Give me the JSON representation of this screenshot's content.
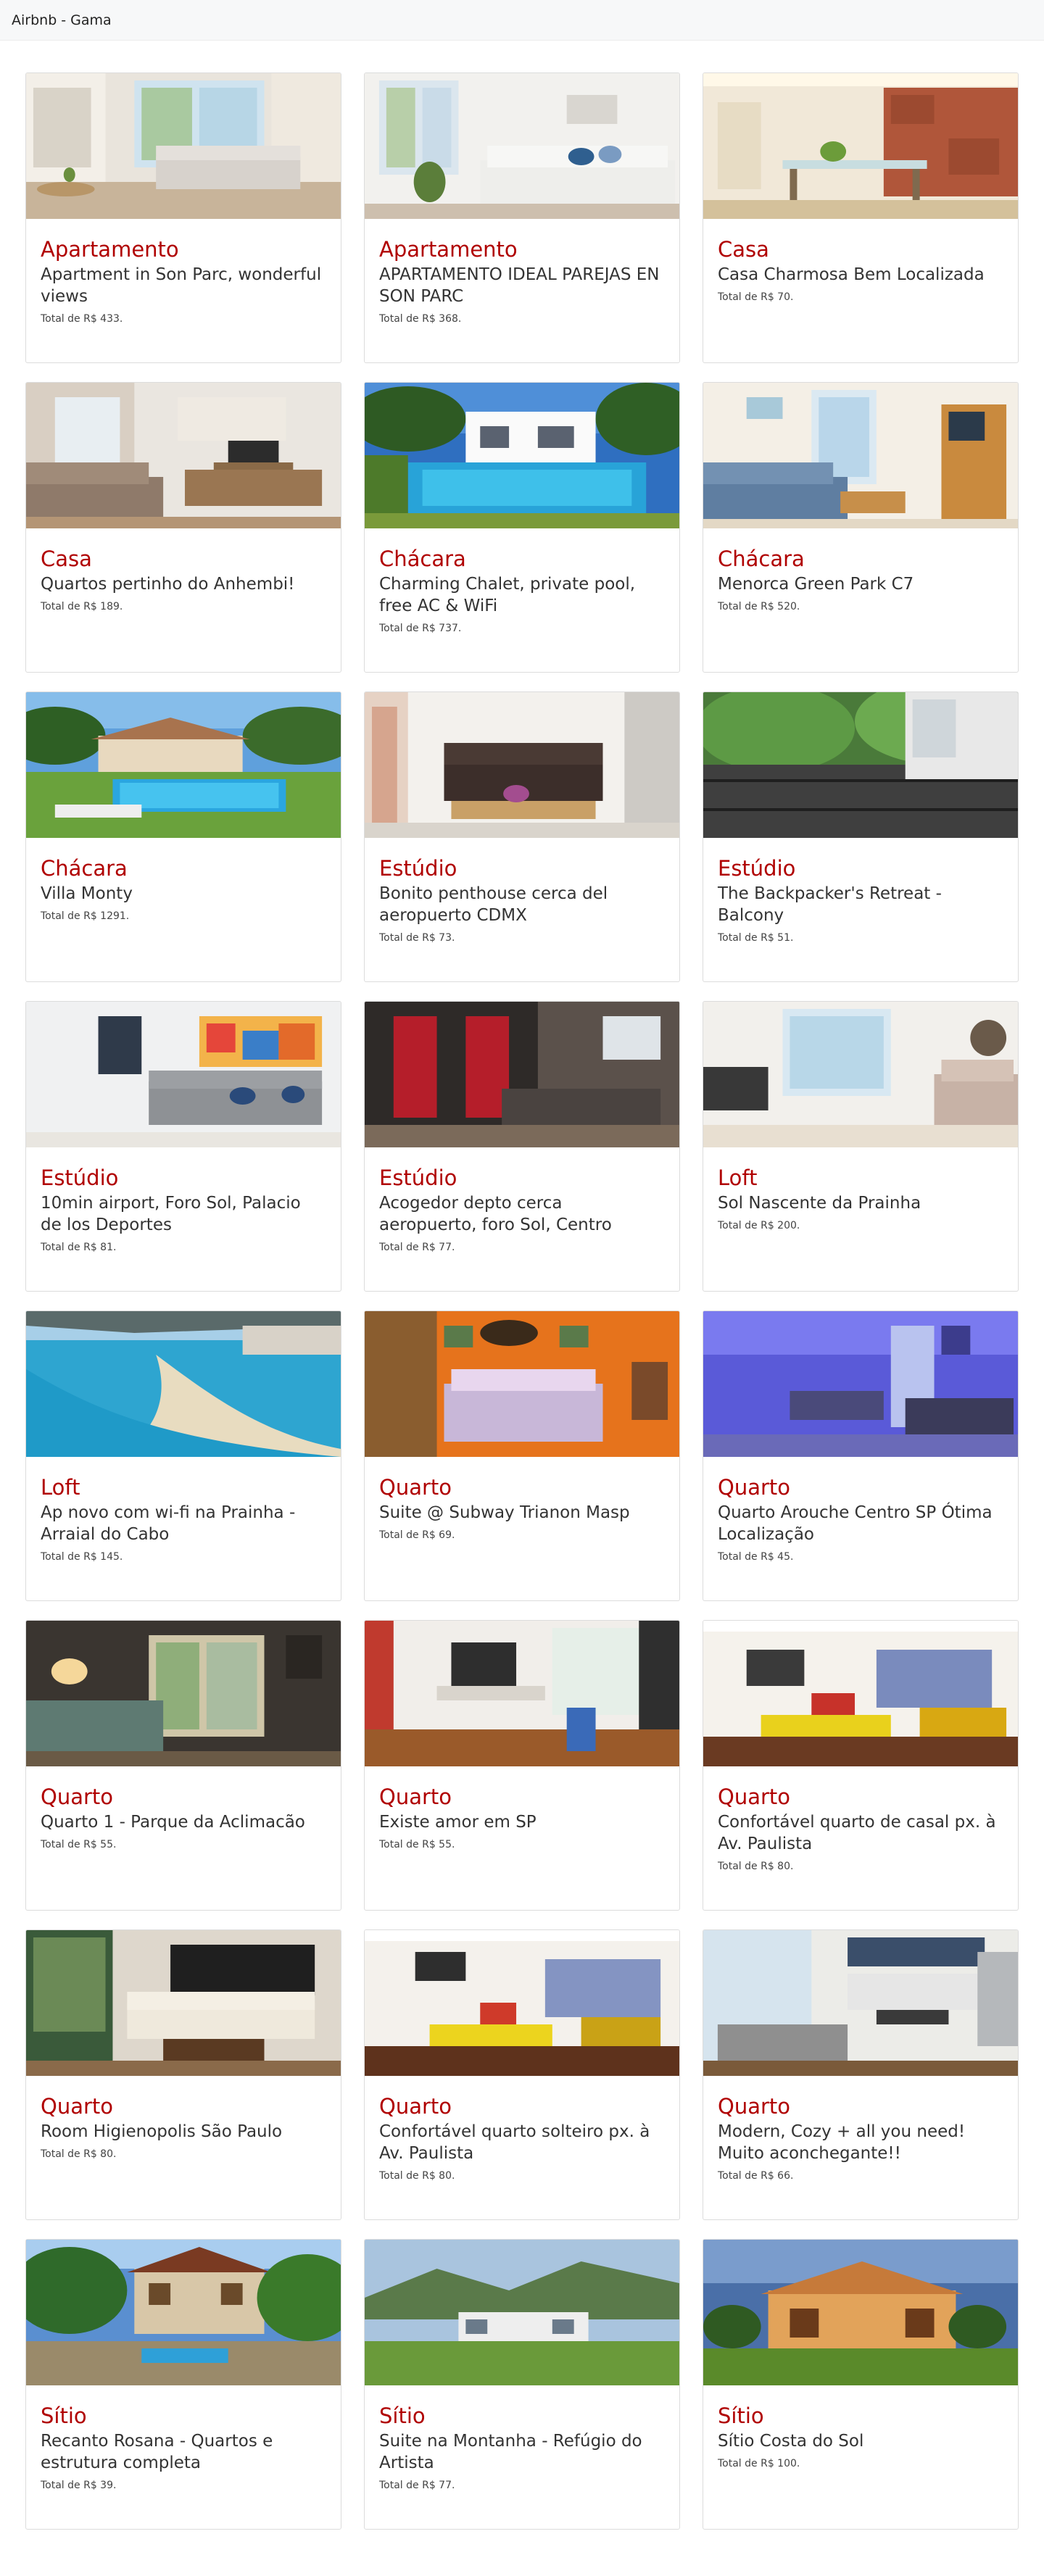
{
  "navbar": {
    "brand": "Airbnb - Gama"
  },
  "listings": [
    {
      "type": "Apartamento",
      "name": "Apartment in Son Parc, wonderful views",
      "price": "Total de R$ 433.",
      "scene": "apartment-living-room"
    },
    {
      "type": "Apartamento",
      "name": "APARTAMENTO IDEAL PAREJAS EN SON PARC",
      "price": "Total de R$ 368.",
      "scene": "white-sofa-room"
    },
    {
      "type": "Casa",
      "name": "Casa Charmosa Bem Localizada",
      "price": "Total de R$ 70.",
      "scene": "brick-dining-room"
    },
    {
      "type": "Casa",
      "name": "Quartos pertinho do Anhembi!",
      "price": "Total de R$ 189.",
      "scene": "wood-tv-room"
    },
    {
      "type": "Chácara",
      "name": "Charming Chalet, private pool, free AC & WiFi",
      "price": "Total de R$ 737.",
      "scene": "pool-chalet"
    },
    {
      "type": "Chácara",
      "name": "Menorca Green Park C7",
      "price": "Total de R$ 520.",
      "scene": "blue-sofa-room"
    },
    {
      "type": "Chácara",
      "name": "Villa Monty",
      "price": "Total de R$ 1291.",
      "scene": "villa-pool"
    },
    {
      "type": "Estúdio",
      "name": "Bonito penthouse cerca del aeropuerto CDMX",
      "price": "Total de R$ 73.",
      "scene": "brown-sofa-studio"
    },
    {
      "type": "Estúdio",
      "name": "The Backpacker's Retreat - Balcony",
      "price": "Total de R$ 51.",
      "scene": "balcony-trees"
    },
    {
      "type": "Estúdio",
      "name": "10min airport, Foro Sol, Palacio de los Deportes",
      "price": "Total de R$ 81.",
      "scene": "art-grey-sofa"
    },
    {
      "type": "Estúdio",
      "name": "Acogedor depto cerca aeropuerto, foro Sol, Centro",
      "price": "Total de R$ 77.",
      "scene": "red-doors-loft"
    },
    {
      "type": "Loft",
      "name": "Sol Nascente da Prainha",
      "price": "Total de R$ 200.",
      "scene": "bright-loft"
    },
    {
      "type": "Loft",
      "name": "Ap novo com wi-fi na Prainha - Arraial do Cabo",
      "price": "Total de R$ 145.",
      "scene": "beach-view"
    },
    {
      "type": "Quarto",
      "name": "Suite @ Subway Trianon Masp",
      "price": "Total de R$ 69.",
      "scene": "orange-bedroom"
    },
    {
      "type": "Quarto",
      "name": "Quarto Arouche Centro SP Ótima Localização",
      "price": "Total de R$ 45.",
      "scene": "purple-room"
    },
    {
      "type": "Quarto",
      "name": "Quarto 1 - Parque da Aclimacão",
      "price": "Total de R$ 55.",
      "scene": "cozy-lamp-room"
    },
    {
      "type": "Quarto",
      "name": "Existe amor em SP",
      "price": "Total de R$ 55.",
      "scene": "wood-floor-office"
    },
    {
      "type": "Quarto",
      "name": "Confortável quarto de casal px. à Av. Paulista",
      "price": "Total de R$ 80.",
      "scene": "yellow-lounge"
    },
    {
      "type": "Quarto",
      "name": "Room Higienopolis São Paulo",
      "price": "Total de R$ 80.",
      "scene": "cream-living"
    },
    {
      "type": "Quarto",
      "name": "Confortável quarto solteiro px. à Av. Paulista",
      "price": "Total de R$ 80.",
      "scene": "yellow-lounge-2"
    },
    {
      "type": "Quarto",
      "name": "Modern, Cozy + all you need! Muito aconchegante!!",
      "price": "Total de R$ 66.",
      "scene": "modern-kitchen"
    },
    {
      "type": "Sítio",
      "name": "Recanto Rosana - Quartos e estrutura completa",
      "price": "Total de R$ 39.",
      "scene": "garden-house"
    },
    {
      "type": "Sítio",
      "name": "Suite na Montanha - Refúgio do Artista",
      "price": "Total de R$ 77.",
      "scene": "mountain-house"
    },
    {
      "type": "Sítio",
      "name": "Sítio Costa do Sol",
      "price": "Total de R$ 100.",
      "scene": "golden-villa"
    }
  ],
  "colors": {
    "accent": "#b00000",
    "text": "#333333",
    "border": "#dcdcdc",
    "navbar_bg": "#f7f8f9"
  }
}
